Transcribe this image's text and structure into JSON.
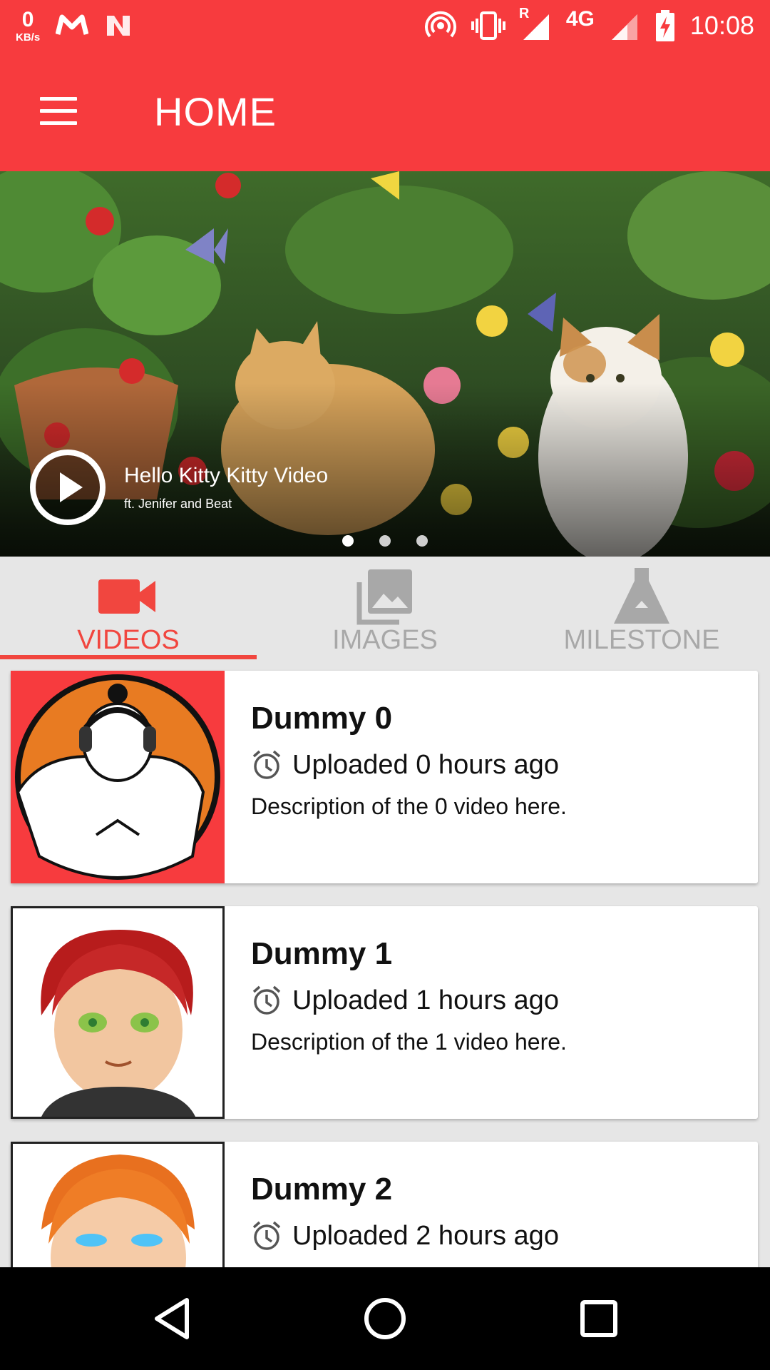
{
  "status_bar": {
    "net_speed_value": "0",
    "net_speed_unit": "KB/s",
    "network_type": "4G",
    "roaming_marker": "R",
    "time": "10:08",
    "icons": [
      "gmail-icon",
      "notification-n-icon",
      "hotspot-icon",
      "vibrate-icon",
      "signal-roaming-icon",
      "signal-icon",
      "battery-charging-icon"
    ]
  },
  "app_bar": {
    "title": "HOME",
    "menu_icon": "hamburger-menu-icon",
    "color": "#f73b3e"
  },
  "banner": {
    "title": "Hello Kitty Kitty Video",
    "subtitle": "ft. Jenifer and Beat",
    "play_icon": "play-circle-icon",
    "slide_count": 3,
    "active_slide": 1
  },
  "tabs": [
    {
      "label": "VIDEOS",
      "icon": "videocam-icon",
      "active": true
    },
    {
      "label": "IMAGES",
      "icon": "photo-library-icon",
      "active": false
    },
    {
      "label": "MILESTONE",
      "icon": "flask-icon",
      "active": false
    }
  ],
  "accent_color": "#f1463f",
  "videos": [
    {
      "title": "Dummy 0",
      "uploaded": "Uploaded 0 hours ago",
      "description": "Description of the 0 video here."
    },
    {
      "title": "Dummy 1",
      "uploaded": "Uploaded 1 hours ago",
      "description": "Description of the 1 video here."
    },
    {
      "title": "Dummy 2",
      "uploaded": "Uploaded 2 hours ago",
      "description": ""
    }
  ],
  "nav_bar": {
    "icons": [
      "back-icon",
      "home-icon",
      "recents-icon"
    ]
  }
}
